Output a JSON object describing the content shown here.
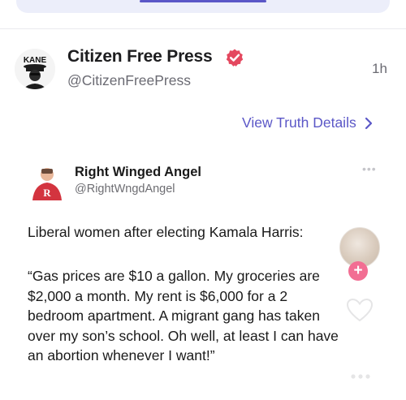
{
  "post": {
    "author_name": "Citizen Free Press",
    "author_handle": "@CitizenFreePress",
    "timestamp": "1h",
    "avatar_text": "KANE",
    "view_details_label": "View Truth Details"
  },
  "embedded": {
    "author_name": "Right Winged Angel",
    "author_handle": "@RightWngdAngel",
    "more_label": "•••",
    "avatar_letter": "R",
    "intro": "Liberal women after electing Kamala Harris:",
    "quote_lines": [
      "“Gas prices are $10 a gallon.  My groceries are",
      "$2,000 a month.  My rent is $6,000 for a 2",
      "bedroom apartment.  A migrant gang has taken",
      "over my son’s school.  Oh well, at least I can have",
      "an abortion whenever I want!”"
    ],
    "side_avatar_plus": "+"
  },
  "colors": {
    "accent": "#5b57c7",
    "verified": "#e4485f",
    "plus_badge": "#f26e93",
    "embed_avatar_red": "#d3343f"
  },
  "icons": [
    "verified-badge-icon",
    "chevron-right-icon",
    "heart-icon",
    "more-dots-icon"
  ]
}
